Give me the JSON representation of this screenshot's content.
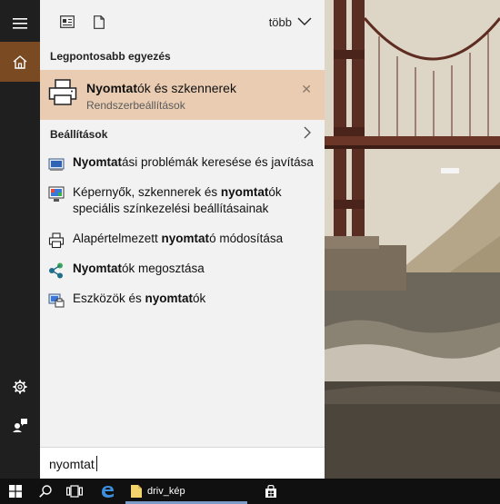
{
  "toolbar": {
    "more_label": "több",
    "icons": [
      "news-icon",
      "document-icon",
      "chevron-down-icon"
    ]
  },
  "best_match": {
    "heading": "Legpontosabb egyezés",
    "title_bold": "Nyomtat",
    "title_rest": "ók és szkennerek",
    "subtitle": "Rendszerbeállítások",
    "close": "✕"
  },
  "settings_section": {
    "heading": "Beállítások",
    "items": [
      {
        "parts": [
          {
            "t": "Nyomtat",
            "b": true
          },
          {
            "t": "ási problémák keresése és javítása",
            "b": false
          }
        ]
      },
      {
        "parts": [
          {
            "t": "Képernyők, szkennerek és ",
            "b": false
          },
          {
            "t": "nyomtat",
            "b": true
          },
          {
            "t": "ók speciális színkezelési beállításainak",
            "b": false
          }
        ]
      },
      {
        "parts": [
          {
            "t": "Alapértelmezett ",
            "b": false
          },
          {
            "t": "nyomtat",
            "b": true
          },
          {
            "t": "ó módosítása",
            "b": false
          }
        ]
      },
      {
        "parts": [
          {
            "t": "Nyomtat",
            "b": true
          },
          {
            "t": "ók megosztása",
            "b": false
          }
        ]
      },
      {
        "parts": [
          {
            "t": "Eszközök és ",
            "b": false
          },
          {
            "t": "nyomtat",
            "b": true
          },
          {
            "t": "ók",
            "b": false
          }
        ]
      }
    ]
  },
  "search": {
    "value": "nyomtat"
  },
  "taskbar": {
    "folder_label": "driv_kép"
  },
  "colors": {
    "accent": "#7a4a22",
    "highlight": "#e9ccb1",
    "panel": "#f2f2f2",
    "taskbar": "#101010"
  }
}
